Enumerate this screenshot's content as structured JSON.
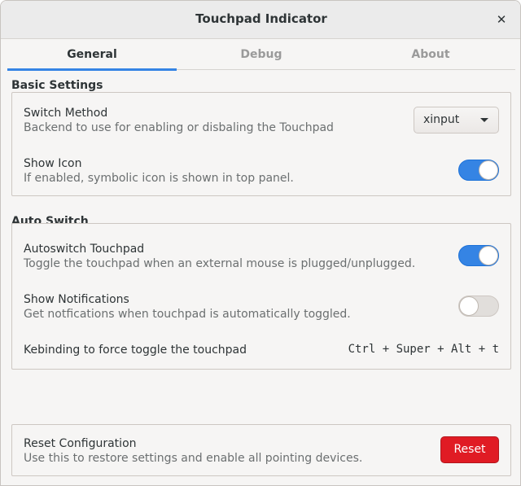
{
  "window": {
    "title": "Touchpad Indicator",
    "close_icon": "close-icon"
  },
  "tabs": [
    {
      "label": "General",
      "active": true
    },
    {
      "label": "Debug",
      "active": false
    },
    {
      "label": "About",
      "active": false
    }
  ],
  "basic_settings": {
    "label": "Basic Settings",
    "switch_method": {
      "title": "Switch Method",
      "subtitle": "Backend to use for enabling or disbaling the Touchpad",
      "value": "xinput"
    },
    "show_icon": {
      "title": "Show Icon",
      "subtitle": "If enabled, symbolic icon is shown in top panel.",
      "enabled": true
    }
  },
  "auto_switch": {
    "label": "Auto Switch",
    "autoswitch_touchpad": {
      "title": "Autoswitch Touchpad",
      "subtitle": "Toggle the touchpad when an external mouse is plugged/unplugged.",
      "enabled": true
    },
    "show_notifications": {
      "title": "Show Notifications",
      "subtitle": "Get notfications when touchpad is automatically toggled.",
      "enabled": false
    },
    "keybinding": {
      "title": "Kebinding to force toggle the touchpad",
      "shortcut": "Ctrl + Super + Alt + t"
    }
  },
  "reset": {
    "title": "Reset Configuration",
    "subtitle": "Use this to restore settings and enable all pointing devices.",
    "button_label": "Reset"
  },
  "colors": {
    "accent": "#3584e4",
    "destructive": "#e01b24"
  }
}
